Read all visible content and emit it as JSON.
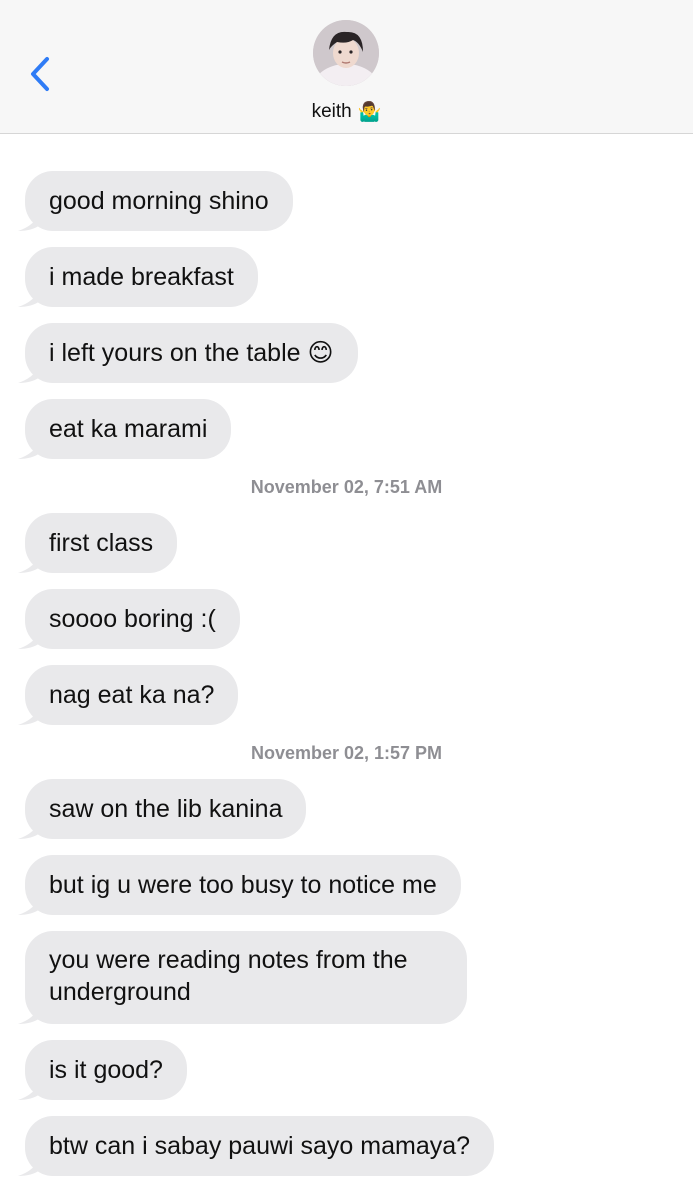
{
  "header": {
    "contact_name": "keith",
    "contact_emoji": "🤷‍♂️"
  },
  "messages": [
    {
      "text": "good morning shino"
    },
    {
      "text": "i made breakfast"
    },
    {
      "text": "i left yours on the table 😊"
    },
    {
      "text": "eat ka marami"
    },
    {
      "text": "first class"
    },
    {
      "text": "soooo boring :("
    },
    {
      "text": "nag eat ka na?"
    },
    {
      "text": "saw on the lib kanina"
    },
    {
      "text": "but ig u were too busy to notice me"
    },
    {
      "text": "you were reading notes from the underground"
    },
    {
      "text": "is it good?"
    },
    {
      "text": "btw can i sabay pauwi sayo mamaya?"
    }
  ],
  "timestamps": [
    "November 02, 7:51 AM",
    "November 02, 1:57 PM"
  ],
  "colors": {
    "accent": "#2f7cf6",
    "bubble": "#e9e9eb",
    "timestamp": "#8e8e93"
  }
}
